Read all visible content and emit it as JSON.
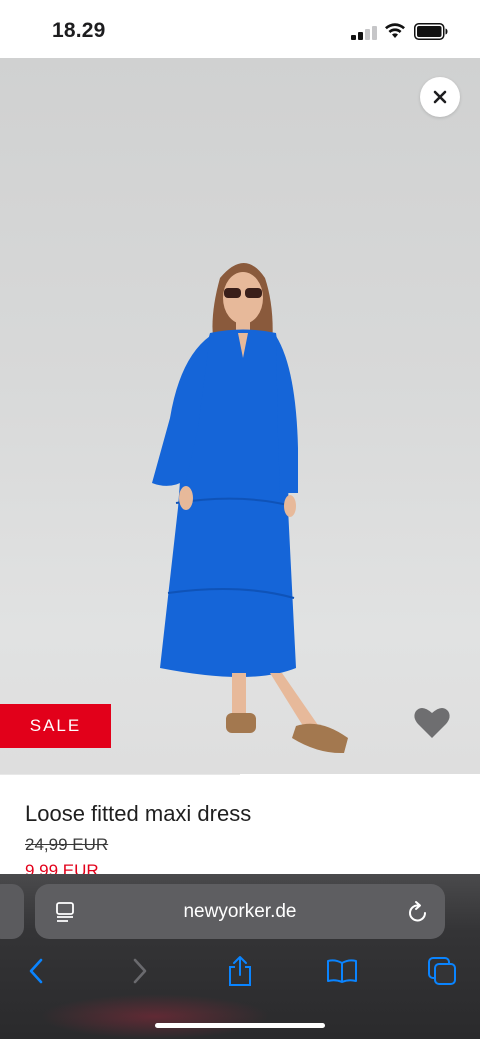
{
  "status_bar": {
    "time": "18.29",
    "icons": [
      "cellular-signal-icon",
      "wifi-icon",
      "battery-icon"
    ]
  },
  "product": {
    "badge": "SALE",
    "title": "Loose fitted maxi dress",
    "original_price": "24,99 EUR",
    "sale_price": "9,99 EUR",
    "dress_color": "#1565d8",
    "sale_color": "#e2001a"
  },
  "browser": {
    "url": "newyorker.de",
    "toolbar": [
      "back-icon",
      "forward-icon",
      "share-icon",
      "bookmarks-icon",
      "tabs-icon"
    ],
    "accent_color": "#0a84ff"
  }
}
